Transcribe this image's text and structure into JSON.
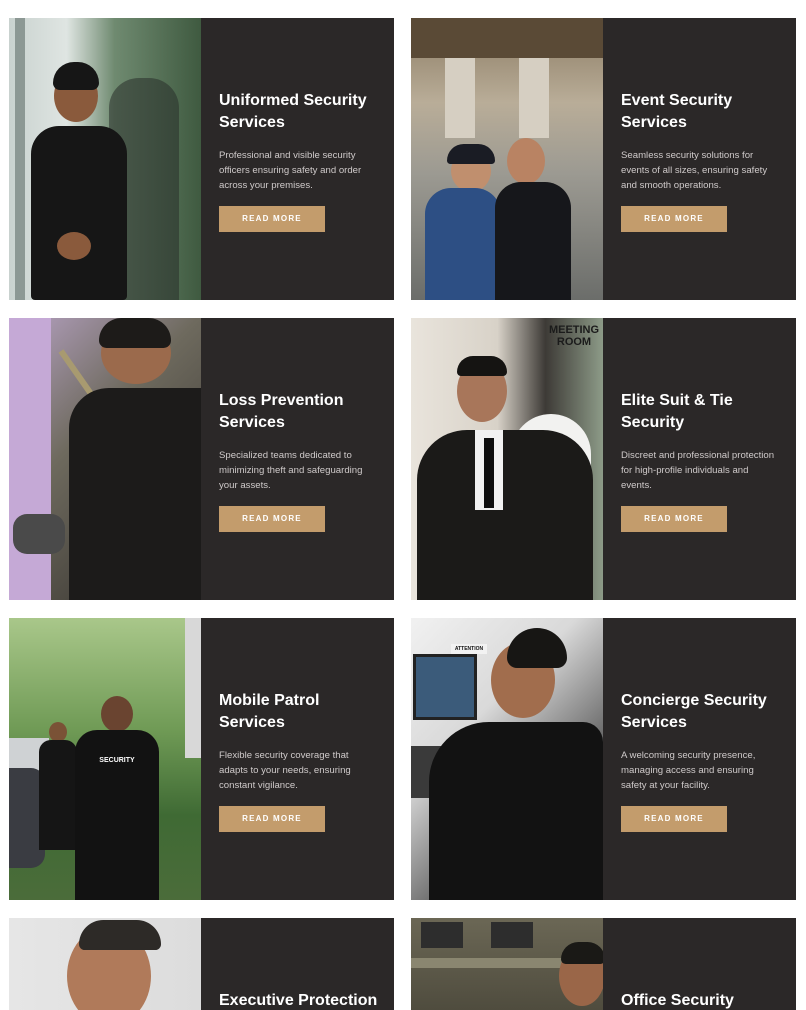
{
  "button_label": "READ MORE",
  "colors": {
    "card_bg": "#2b2828",
    "button_bg": "#c39c6c",
    "title_text": "#ffffff",
    "desc_text": "#cfcaca"
  },
  "services": [
    {
      "title": "Uniformed Security\nServices",
      "description": "Professional and visible security officers ensuring safety and order across your premises.",
      "button": "READ MORE"
    },
    {
      "title": "Event Security\nServices",
      "description": "Seamless security solutions for events of all sizes, ensuring safety and smooth operations.",
      "button": "READ MORE"
    },
    {
      "title": "Loss Prevention\nServices",
      "description": "Specialized teams dedicated to minimizing theft and safeguarding your assets.",
      "button": "READ MORE"
    },
    {
      "title": "Elite Suit & Tie\nSecurity",
      "description": "Discreet and professional protection for high-profile individuals and events.",
      "button": "READ MORE"
    },
    {
      "title": "Mobile Patrol\nServices",
      "description": "Flexible security coverage that adapts to your needs, ensuring constant vigilance.",
      "button": "READ MORE"
    },
    {
      "title": "Concierge Security\nServices",
      "description": "A welcoming security presence, managing access and ensuring safety at your facility.",
      "button": "READ MORE"
    },
    {
      "title": "Executive Protection",
      "description": "",
      "button": ""
    },
    {
      "title": "Office Security",
      "description": "",
      "button": ""
    }
  ],
  "photo_text": {
    "meeting_room": "MEETING\nROOM",
    "vest_logo": "SECURITY",
    "attention_sign": "ATTENTION"
  }
}
